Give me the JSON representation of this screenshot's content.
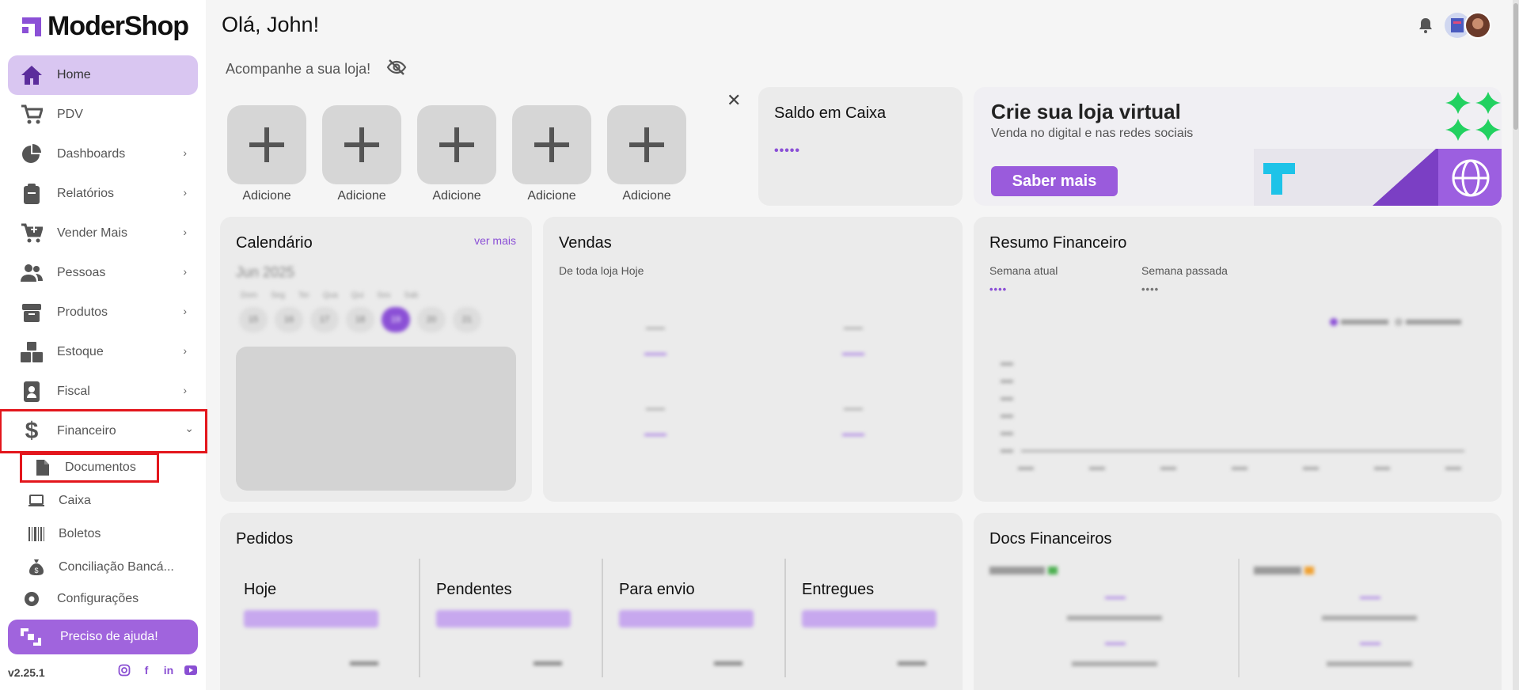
{
  "brand": {
    "name": "ModerShop",
    "accent": "#a064dd"
  },
  "header": {
    "greeting": "Olá, John!",
    "follow_text": "Acompanhe a sua loja!"
  },
  "sidebar": {
    "items": [
      {
        "label": "Home",
        "icon": "home-icon"
      },
      {
        "label": "PDV",
        "icon": "cart-icon"
      },
      {
        "label": "Dashboards",
        "icon": "pie-chart-icon"
      },
      {
        "label": "Relatórios",
        "icon": "clipboard-icon"
      },
      {
        "label": "Vender Mais",
        "icon": "cart-plus-icon"
      },
      {
        "label": "Pessoas",
        "icon": "people-icon"
      },
      {
        "label": "Produtos",
        "icon": "box-icon"
      },
      {
        "label": "Estoque",
        "icon": "boxes-icon"
      },
      {
        "label": "Fiscal",
        "icon": "badge-icon"
      },
      {
        "label": "Financeiro",
        "icon": "dollar-icon"
      }
    ],
    "subitems": [
      {
        "label": "Documentos",
        "icon": "document-icon"
      },
      {
        "label": "Caixa",
        "icon": "laptop-icon"
      },
      {
        "label": "Boletos",
        "icon": "barcode-icon"
      },
      {
        "label": "Conciliação Bancá...",
        "icon": "money-bag-icon"
      }
    ],
    "config_label": "Configurações",
    "help_label": "Preciso de ajuda!",
    "version": "v2.25.1"
  },
  "quick_add": {
    "label": "Adicione",
    "count": 5
  },
  "saldo": {
    "title": "Saldo em Caixa",
    "masked_value": "•••••"
  },
  "banner": {
    "title": "Crie sua loja virtual",
    "subtitle": "Venda no digital e nas redes sociais",
    "button": "Saber mais"
  },
  "calendario": {
    "title": "Calendário",
    "link": "ver mais",
    "month": "Jun 2025",
    "days": [
      "Dom",
      "Seg",
      "Ter",
      "Qua",
      "Qui",
      "Sex",
      "Sab"
    ],
    "dates": [
      "15",
      "16",
      "17",
      "18",
      "19",
      "20",
      "21"
    ]
  },
  "vendas": {
    "title": "Vendas",
    "subtitle": "De toda loja Hoje"
  },
  "resumo": {
    "title": "Resumo Financeiro",
    "week_current": "Semana atual",
    "week_last": "Semana passada",
    "masked_current": "••••",
    "masked_last": "••••"
  },
  "pedidos": {
    "title": "Pedidos",
    "columns": [
      "Hoje",
      "Pendentes",
      "Para envio",
      "Entregues"
    ]
  },
  "docs": {
    "title": "Docs Financeiros"
  }
}
